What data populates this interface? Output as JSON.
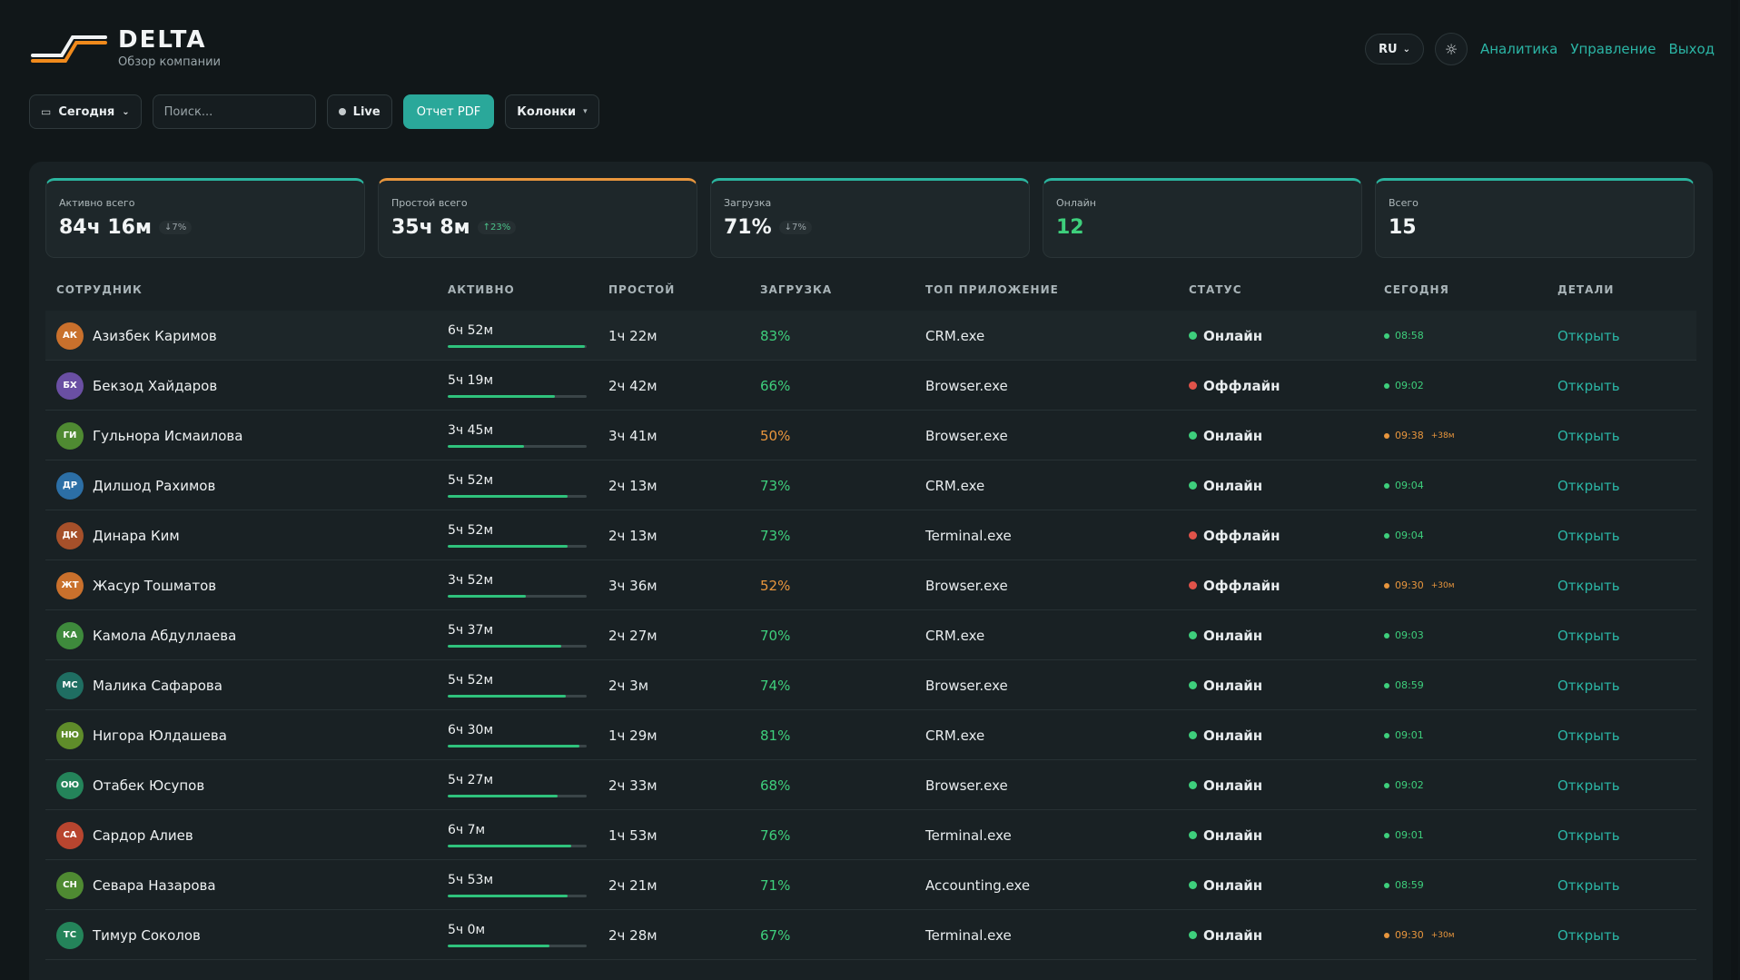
{
  "brand": {
    "name": "DELTA",
    "subtitle": "Обзор компании"
  },
  "topnav": {
    "lang": "RU",
    "links": [
      "Аналитика",
      "Управление",
      "Выход"
    ]
  },
  "toolbar": {
    "period": "Сегодня",
    "search_placeholder": "Поиск...",
    "live": "Live",
    "pdf": "Отчет PDF",
    "columns": "Колонки"
  },
  "stats": [
    {
      "label": "Активно всего",
      "value": "84ч 16м",
      "delta": "↓7%"
    },
    {
      "label": "Простой всего",
      "value": "35ч 8м",
      "delta": "↑23%"
    },
    {
      "label": "Загрузка",
      "value": "71%",
      "delta": "↓7%"
    },
    {
      "label": "Онлайн",
      "value": "12"
    },
    {
      "label": "Всего",
      "value": "15"
    }
  ],
  "table": {
    "headers": [
      "СОТРУДНИК",
      "АКТИВНО",
      "ПРОСТОЙ",
      "ЗАГРУЗКА",
      "ТОП ПРИЛОЖЕНИЕ",
      "СТАТУС",
      "СЕГОДНЯ",
      "ДЕТАЛИ"
    ],
    "rows": [
      {
        "initials": "АК",
        "avatar_color": "#c9702c",
        "name": "Азизбек Каримов",
        "active": "6ч 52м",
        "active_fraction": 0.99,
        "idle": "1ч 22м",
        "load": "83%",
        "load_level": "green",
        "app": "CRM.exe",
        "status": "Онлайн",
        "online": true,
        "today": "08:58",
        "today_late": "",
        "action": "Открыть"
      },
      {
        "initials": "БХ",
        "avatar_color": "#6a4fa3",
        "name": "Бекзод Хайдаров",
        "active": "5ч 19м",
        "active_fraction": 0.77,
        "idle": "2ч 42м",
        "load": "66%",
        "load_level": "green",
        "app": "Browser.exe",
        "status": "Оффлайн",
        "online": false,
        "today": "09:02",
        "today_late": "",
        "action": "Открыть"
      },
      {
        "initials": "ГИ",
        "avatar_color": "#4f8a32",
        "name": "Гульнора Исмаилова",
        "active": "3ч 45м",
        "active_fraction": 0.55,
        "idle": "3ч 41м",
        "load": "50%",
        "load_level": "orange",
        "app": "Browser.exe",
        "status": "Онлайн",
        "online": true,
        "today": "09:38",
        "today_late": "+38м",
        "action": "Открыть"
      },
      {
        "initials": "ДР",
        "avatar_color": "#2c6fa6",
        "name": "Дилшод Рахимов",
        "active": "5ч 52м",
        "active_fraction": 0.86,
        "idle": "2ч 13м",
        "load": "73%",
        "load_level": "green",
        "app": "CRM.exe",
        "status": "Онлайн",
        "online": true,
        "today": "09:04",
        "today_late": "",
        "action": "Открыть"
      },
      {
        "initials": "ДК",
        "avatar_color": "#a6502a",
        "name": "Динара Ким",
        "active": "5ч 52м",
        "active_fraction": 0.86,
        "idle": "2ч 13м",
        "load": "73%",
        "load_level": "green",
        "app": "Terminal.exe",
        "status": "Оффлайн",
        "online": false,
        "today": "09:04",
        "today_late": "",
        "action": "Открыть"
      },
      {
        "initials": "ЖТ",
        "avatar_color": "#c9702c",
        "name": "Жасур Тошматов",
        "active": "3ч 52м",
        "active_fraction": 0.56,
        "idle": "3ч 36м",
        "load": "52%",
        "load_level": "orange",
        "app": "Browser.exe",
        "status": "Оффлайн",
        "online": false,
        "today": "09:30",
        "today_late": "+30м",
        "action": "Открыть"
      },
      {
        "initials": "КА",
        "avatar_color": "#3e8a3c",
        "name": "Камола Абдуллаева",
        "active": "5ч 37м",
        "active_fraction": 0.82,
        "idle": "2ч 27м",
        "load": "70%",
        "load_level": "green",
        "app": "CRM.exe",
        "status": "Онлайн",
        "online": true,
        "today": "09:03",
        "today_late": "",
        "action": "Открыть"
      },
      {
        "initials": "МС",
        "avatar_color": "#1f6e62",
        "name": "Малика Сафарова",
        "active": "5ч 52м",
        "active_fraction": 0.85,
        "idle": "2ч 3м",
        "load": "74%",
        "load_level": "green",
        "app": "Browser.exe",
        "status": "Онлайн",
        "online": true,
        "today": "08:59",
        "today_late": "",
        "action": "Открыть"
      },
      {
        "initials": "НЮ",
        "avatar_color": "#5f8c2a",
        "name": "Нигора Юлдашева",
        "active": "6ч 30м",
        "active_fraction": 0.95,
        "idle": "1ч 29м",
        "load": "81%",
        "load_level": "green",
        "app": "CRM.exe",
        "status": "Онлайн",
        "online": true,
        "today": "09:01",
        "today_late": "",
        "action": "Открыть"
      },
      {
        "initials": "ОЮ",
        "avatar_color": "#24845a",
        "name": "Отабек Юсупов",
        "active": "5ч 27м",
        "active_fraction": 0.79,
        "idle": "2ч 33м",
        "load": "68%",
        "load_level": "green",
        "app": "Browser.exe",
        "status": "Онлайн",
        "online": true,
        "today": "09:02",
        "today_late": "",
        "action": "Открыть"
      },
      {
        "initials": "СА",
        "avatar_color": "#b8452f",
        "name": "Сардор Алиев",
        "active": "6ч 7м",
        "active_fraction": 0.89,
        "idle": "1ч 53м",
        "load": "76%",
        "load_level": "green",
        "app": "Terminal.exe",
        "status": "Онлайн",
        "online": true,
        "today": "09:01",
        "today_late": "",
        "action": "Открыть"
      },
      {
        "initials": "СН",
        "avatar_color": "#4f8a32",
        "name": "Севара Назарова",
        "active": "5ч 53м",
        "active_fraction": 0.86,
        "idle": "2ч 21м",
        "load": "71%",
        "load_level": "green",
        "app": "Accounting.exe",
        "status": "Онлайн",
        "online": true,
        "today": "08:59",
        "today_late": "",
        "action": "Открыть"
      },
      {
        "initials": "ТС",
        "avatar_color": "#24845a",
        "name": "Тимур Соколов",
        "active": "5ч 0м",
        "active_fraction": 0.73,
        "idle": "2ч 28м",
        "load": "67%",
        "load_level": "green",
        "app": "Terminal.exe",
        "status": "Онлайн",
        "online": true,
        "today": "09:30",
        "today_late": "+30м",
        "action": "Открыть"
      }
    ]
  },
  "colors": {
    "accent": "#2bb5a5",
    "online": "#3ecf7c",
    "offline": "#e0534a",
    "warn": "#e8963d"
  }
}
